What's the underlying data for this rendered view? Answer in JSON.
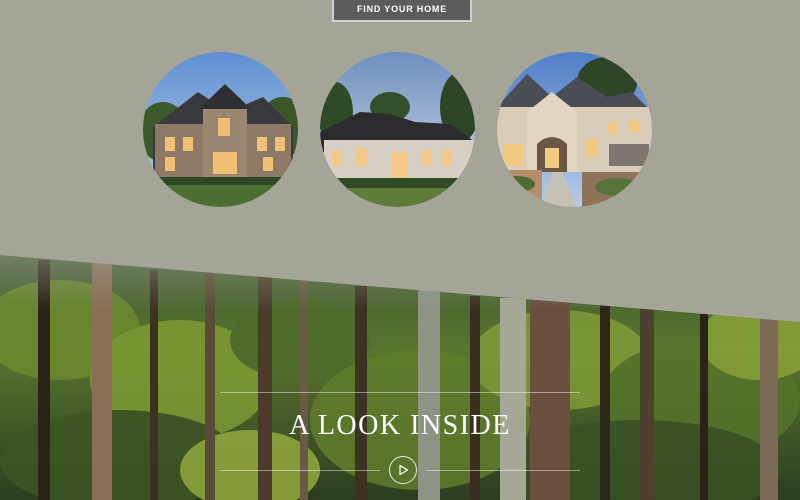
{
  "header": {
    "find_button_label": "FIND YOUR HOME"
  },
  "homes": [
    {
      "name": "home-photo-stone"
    },
    {
      "name": "home-photo-stucco"
    },
    {
      "name": "home-photo-cream"
    }
  ],
  "section": {
    "title": "A LOOK INSIDE"
  },
  "icons": {
    "play": "play-circle-icon"
  },
  "colors": {
    "background": "#a4a597",
    "button": "#5b5c5e",
    "text": "#ffffff"
  }
}
